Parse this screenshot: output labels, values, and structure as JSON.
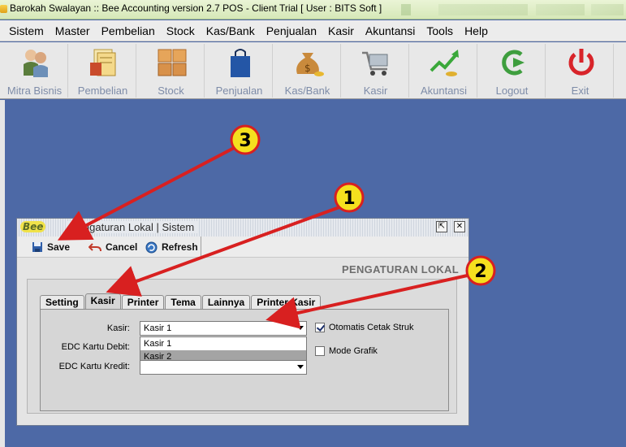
{
  "app": {
    "title": "Barokah Swalayan :: Bee Accounting version 2.7 POS - Client Trial [ User : BITS Soft ]"
  },
  "menu": [
    "Sistem",
    "Master",
    "Pembelian",
    "Stock",
    "Kas/Bank",
    "Penjualan",
    "Kasir",
    "Akuntansi",
    "Tools",
    "Help"
  ],
  "toolbar": [
    {
      "label": "Mitra Bisnis",
      "icon": "partners-icon"
    },
    {
      "label": "Pembelian",
      "icon": "purchase-docs-icon"
    },
    {
      "label": "Stock",
      "icon": "boxes-icon"
    },
    {
      "label": "Penjualan",
      "icon": "shopping-bag-icon"
    },
    {
      "label": "Kas/Bank",
      "icon": "money-bag-icon"
    },
    {
      "label": "Kasir",
      "icon": "cart-icon"
    },
    {
      "label": "Akuntansi",
      "icon": "growth-chart-icon"
    },
    {
      "label": "Logout",
      "icon": "logout-arrow-icon"
    },
    {
      "label": "Exit",
      "icon": "power-icon"
    }
  ],
  "window": {
    "logo": "Bee",
    "title": "Pengaturan Lokal | Sistem",
    "header": "PENGATURAN LOKAL",
    "actions": {
      "save": "Save",
      "cancel": "Cancel",
      "refresh": "Refresh"
    },
    "tabs": [
      "Setting",
      "Kasir",
      "Printer",
      "Tema",
      "Lainnya",
      "Printer Kasir"
    ],
    "active_tab": "Kasir",
    "form": {
      "kasir_label": "Kasir:",
      "kasir_value": "Kasir 1",
      "kasir_options": [
        "Kasir 1",
        "Kasir 2"
      ],
      "edc_debit_label": "EDC Kartu Debit:",
      "edc_kredit_label": "EDC Kartu Kredit:",
      "edc_kredit_value": "",
      "cetak_struk_label": "Otomatis Cetak Struk",
      "cetak_struk_checked": true,
      "mode_grafik_label": "Mode Grafik",
      "mode_grafik_checked": false
    }
  },
  "annotations": {
    "badges": [
      "1",
      "2",
      "3"
    ],
    "arrow_color": "#d82020",
    "badge_fill": "#f5e01e"
  }
}
